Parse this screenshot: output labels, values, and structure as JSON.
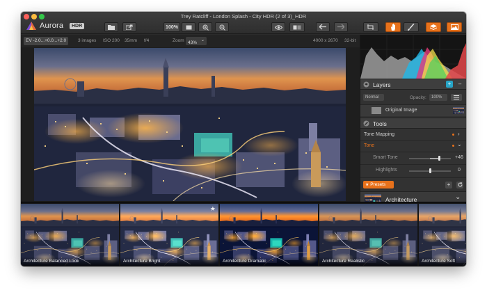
{
  "window": {
    "title": "Trey Ratcliff - London Splash - City HDR (2 of 3)_HDR"
  },
  "app": {
    "name": "Aurora",
    "badge": "HDR"
  },
  "toolbar": {
    "zoom_label": "100%"
  },
  "infobar": {
    "ev": "EV -2.0...+0.0...+2.0",
    "images": "3 images",
    "iso": "ISO 200",
    "focal": "35mm",
    "aperture": "f/4",
    "zoom_label": "Zoom",
    "zoom_value": "43%",
    "dimensions": "4000 x 2670",
    "bit_depth": "32-bit"
  },
  "layers": {
    "title": "Layers",
    "blend_mode": "Normal",
    "opacity_label": "Opacity:",
    "opacity_value": "100%",
    "layer_name": "Original Image"
  },
  "tools": {
    "title": "Tools",
    "tone_mapping": "Tone Mapping",
    "tone": "Tone",
    "smart_tone_label": "Smart Tone",
    "smart_tone_value": "+46",
    "smart_tone_level": 0.73,
    "highlights_label": "Highlights",
    "highlights_value": "0",
    "highlights_level": 0.5
  },
  "presets": {
    "button_label": "Presets",
    "category": "Architecture",
    "items": [
      {
        "label": "Architecture Balanced Look"
      },
      {
        "label": "Architecture Bright"
      },
      {
        "label": "Architecture Dramatic"
      },
      {
        "label": "Architecture Realistic"
      },
      {
        "label": "Architecture Soft"
      }
    ]
  },
  "colors": {
    "accent_orange": "#e7711b",
    "accent_blue": "#27a5c7",
    "panel_bg": "#323232"
  },
  "icons": [
    "open-folder-icon",
    "share-icon",
    "fit-screen-icon",
    "zoom-in-icon",
    "zoom-out-icon",
    "eye-icon",
    "compare-icon",
    "undo-icon",
    "redo-icon",
    "crop-icon",
    "hand-icon",
    "brush-icon",
    "layers-icon",
    "histogram-icon"
  ]
}
